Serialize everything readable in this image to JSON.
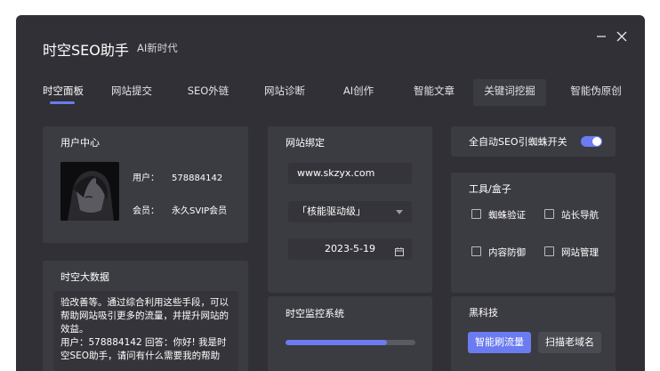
{
  "header": {
    "title": "时空SEO助手",
    "subtitle": "AI新时代"
  },
  "tabs": [
    "时空面板",
    "网站提交",
    "SEO外链",
    "网站诊断",
    "AI创作",
    "智能文章",
    "关键词挖掘",
    "智能伪原创"
  ],
  "user_center": {
    "title": "用户中心",
    "user_label": "用户：",
    "user_value": "578884142",
    "member_label": "会员：",
    "member_value": "永久SVIP会员"
  },
  "site_binding": {
    "title": "网站绑定",
    "url": "www.skzyx.com",
    "driver_level": "「核能驱动级」",
    "date": "2023-5-19"
  },
  "auto_spider": {
    "label": "全自动SEO引蜘蛛开关",
    "enabled": true
  },
  "toolbox": {
    "title": "工具/盒子",
    "items": [
      "蜘蛛验证",
      "站长导航",
      "内容防御",
      "网站管理"
    ]
  },
  "big_data": {
    "title": "时空大数据",
    "lines": [
      "验改善等。通过综合利用这些手段，可以",
      "帮助网站吸引更多的流量，并提升网站的",
      "效益。",
      "用户：578884142  回答：你好! 我是时",
      "空SEO助手，请问有什么需要我的帮助"
    ]
  },
  "monitor": {
    "title": "时空监控系统",
    "progress_percent": 78
  },
  "black_tech": {
    "title": "黑科技",
    "primary_label": "智能刷流量",
    "secondary_label": "扫描老域名"
  },
  "colors": {
    "accent": "#6b7bf0",
    "window_bg": "#303036",
    "card_bg": "#3b3b42"
  }
}
